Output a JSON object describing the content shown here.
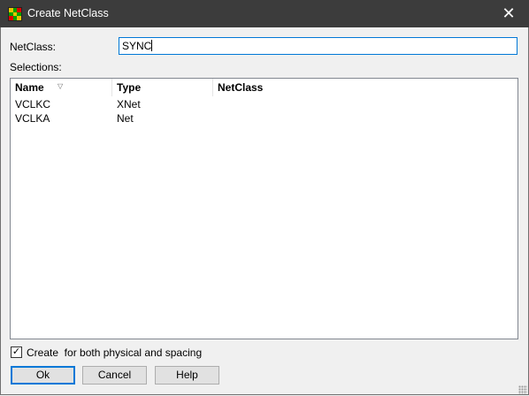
{
  "window": {
    "title": "Create NetClass",
    "close_glyph": "✕"
  },
  "form": {
    "netclass_label": "NetClass:",
    "netclass_value": "SYNC",
    "selections_label": "Selections:"
  },
  "table": {
    "columns": [
      "Name",
      "Type",
      "NetClass"
    ],
    "rows": [
      {
        "name": "VCLKC",
        "type": "XNet",
        "netclass": ""
      },
      {
        "name": "VCLKA",
        "type": "Net",
        "netclass": ""
      }
    ]
  },
  "options": {
    "create_checked": true,
    "create_label": "Create  for both physical and spacing"
  },
  "buttons": {
    "ok": "Ok",
    "cancel": "Cancel",
    "help": "Help"
  },
  "colors": {
    "titlebar": "#3c3c3c",
    "focus_accent": "#0078d7"
  }
}
